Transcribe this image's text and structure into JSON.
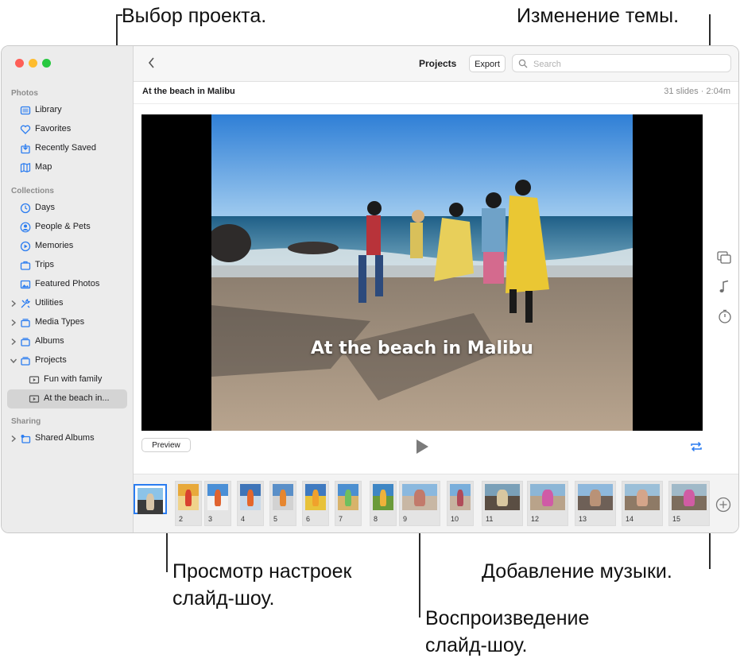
{
  "callouts": {
    "select_project": "Выбор проекта.",
    "change_theme": "Изменение темы.",
    "preview_settings_1": "Просмотр настроек",
    "preview_settings_2": "слайд-шоу.",
    "add_music": "Добавление музыки.",
    "play_1": "Воспроизведение",
    "play_2": "слайд-шоу."
  },
  "colors": {
    "accent": "#2a7cf0",
    "close": "#fe5f57",
    "minimize": "#febc2e",
    "zoom": "#28c840"
  },
  "sidebar": {
    "sections": {
      "photos": "Photos",
      "collections": "Collections",
      "sharing": "Sharing"
    },
    "items": [
      {
        "label": "Library",
        "icon": "library-icon"
      },
      {
        "label": "Favorites",
        "icon": "heart-icon"
      },
      {
        "label": "Recently Saved",
        "icon": "recently-saved-icon"
      },
      {
        "label": "Map",
        "icon": "map-icon"
      },
      {
        "label": "Days",
        "icon": "clock-icon"
      },
      {
        "label": "People & Pets",
        "icon": "person-icon"
      },
      {
        "label": "Memories",
        "icon": "memories-icon"
      },
      {
        "label": "Trips",
        "icon": "suitcase-icon"
      },
      {
        "label": "Featured Photos",
        "icon": "photo-icon"
      },
      {
        "label": "Utilities",
        "icon": "utilities-icon"
      },
      {
        "label": "Media Types",
        "icon": "stack-icon"
      },
      {
        "label": "Albums",
        "icon": "stack-icon"
      },
      {
        "label": "Projects",
        "icon": "stack-icon"
      },
      {
        "label": "Fun with family",
        "icon": "slideshow-icon"
      },
      {
        "label": "At the beach in...",
        "icon": "slideshow-icon"
      },
      {
        "label": "Shared Albums",
        "icon": "shared-album-icon"
      }
    ]
  },
  "toolbar": {
    "title": "Projects",
    "export_label": "Export",
    "search_placeholder": "Search"
  },
  "project": {
    "name": "At the beach in Malibu",
    "meta": "31 slides · 2:04m",
    "slide_title": "At the beach in Malibu"
  },
  "controls": {
    "preview_label": "Preview"
  },
  "strip": {
    "selected_index": 0,
    "slides": [
      {
        "num": ""
      },
      {
        "num": "2"
      },
      {
        "num": "3"
      },
      {
        "num": "4"
      },
      {
        "num": "5"
      },
      {
        "num": "6"
      },
      {
        "num": "7"
      },
      {
        "num": "8"
      },
      {
        "num": "9"
      },
      {
        "num": "10"
      },
      {
        "num": "11"
      },
      {
        "num": "12"
      },
      {
        "num": "13"
      },
      {
        "num": "14"
      },
      {
        "num": "15"
      }
    ]
  }
}
